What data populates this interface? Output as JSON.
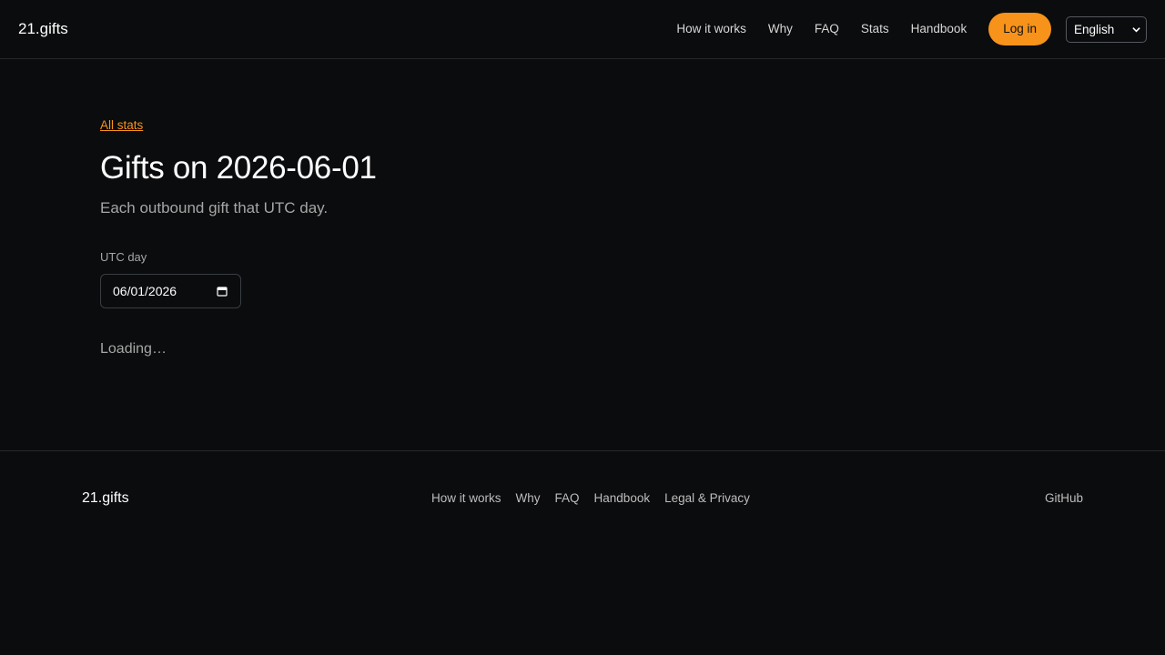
{
  "header": {
    "brand": "21.gifts",
    "nav": [
      "How it works",
      "Why",
      "FAQ",
      "Stats",
      "Handbook"
    ],
    "login_label": "Log in",
    "language": "English"
  },
  "main": {
    "back_link": "All stats",
    "title": "Gifts on 2026-06-01",
    "subtitle": "Each outbound gift that UTC day.",
    "field_label": "UTC day",
    "date_value": "06/01/2026",
    "loading_text": "Loading…"
  },
  "footer": {
    "brand": "21.gifts",
    "links": [
      "How it works",
      "Why",
      "FAQ",
      "Handbook",
      "Legal & Privacy"
    ],
    "github": "GitHub"
  },
  "colors": {
    "background": "#0b0c0e",
    "accent": "#f7931a",
    "muted_text": "#a6a6a6",
    "border": "#26282c"
  },
  "icons": {
    "date_picker": "calendar-icon",
    "select": "chevron-down-icon"
  }
}
